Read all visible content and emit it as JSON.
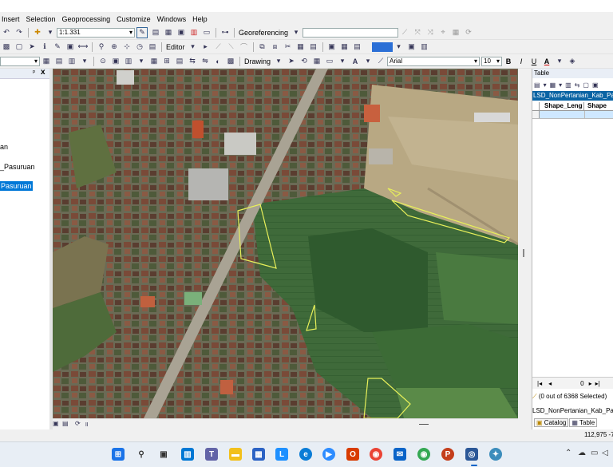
{
  "menu": [
    "Insert",
    "Selection",
    "Geoprocessing",
    "Customize",
    "Windows",
    "Help"
  ],
  "toolbar": {
    "scale": "1:1.331",
    "georeferencing_label": "Georeferencing",
    "editor_label": "Editor",
    "drawing_label": "Drawing",
    "font_name": "Arial",
    "font_size": "10",
    "bold": "B",
    "italic": "I",
    "underline": "U",
    "font_color": "A"
  },
  "toc": {
    "close": "x",
    "pin": "ᵖ",
    "items": [
      "an",
      "_Pasuruan",
      "Pasuruan"
    ]
  },
  "table_panel": {
    "title": "Table",
    "layer_tab": "LSD_NonPertanian_Kab_Pas",
    "columns": [
      "Shape_Leng",
      "Shape"
    ],
    "nav_position": "0",
    "selection_status": "(0 out of 6368 Selected)",
    "footer_layer": "LSD_NonPertanian_Kab_Pasu",
    "bottom_tabs": [
      "Catalog",
      "Table"
    ]
  },
  "status": {
    "coordinates": "112,975  -7"
  },
  "taskbar": {
    "apps": [
      "windows",
      "search",
      "task-view",
      "widgets",
      "teams",
      "file-explorer",
      "store",
      "l-app",
      "edge",
      "zoom",
      "office",
      "chrome",
      "mail",
      "chrome-profile",
      "powerpoint",
      "arcgis",
      "arcmap-globe"
    ],
    "colors": [
      "#1a73e8",
      "#333333",
      "#333333",
      "#0078d4",
      "#6264a7",
      "#f2c01c",
      "#2b62c4",
      "#1e90ff",
      "#0a7cd6",
      "#2d8cff",
      "#d83b01",
      "#ea4335",
      "#0a64c8",
      "#34a853",
      "#c43e1c",
      "#2b5797",
      "#3c8dbc"
    ]
  },
  "colors": {
    "selected_item": "#0078d7",
    "polygon_outline": "#e8f05a",
    "table_header_bg": "#0a64a4"
  }
}
